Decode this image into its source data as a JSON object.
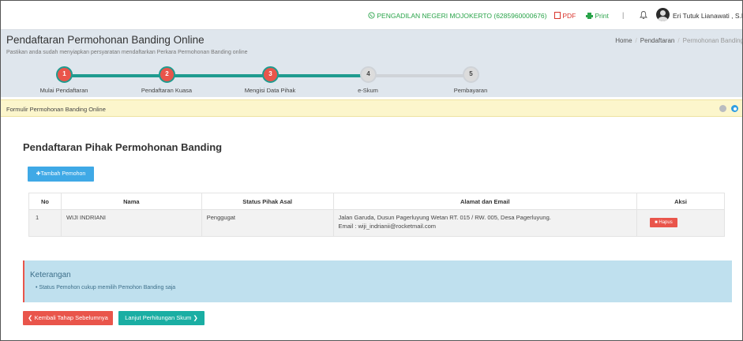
{
  "topbar": {
    "court": "PENGADILAN NEGERI MOJOKERTO (6285960000676)",
    "pdf": "PDF",
    "print": "Print",
    "separator": "|",
    "user": "Eri Tutuk Lianawati , S.H."
  },
  "header": {
    "title": "Pendaftaran Permohonan Banding Online",
    "subtitle": "Pastikan anda sudah menyiapkan persyaratan mendaftarkan Perkara Permohonan Banding online",
    "breadcrumb": [
      "Home",
      "Pendaftaran",
      "Permohonan Banding"
    ]
  },
  "steps": [
    {
      "num": "1",
      "label": "Mulai Pendaftaran"
    },
    {
      "num": "2",
      "label": "Pendaftaran Kuasa"
    },
    {
      "num": "3",
      "label": "Mengisi Data Pihak"
    },
    {
      "num": "4",
      "label": "e-Skum"
    },
    {
      "num": "5",
      "label": "Pembayaran"
    }
  ],
  "formbar": {
    "label": "Formulir Permohonan Banding Online"
  },
  "section": {
    "title": "Pendaftaran Pihak Permohonan Banding",
    "add_button": "Tambah Pemohon"
  },
  "table": {
    "headers": [
      "No",
      "Nama",
      "Status Pihak Asal",
      "Alamat dan Email",
      "Aksi"
    ],
    "rows": [
      {
        "no": "1",
        "nama": "WIJI INDRIANI",
        "status": "Penggugat",
        "alamat": "Jalan Garuda, Dusun Pagerluyung Wetan RT. 015 / RW. 005, Desa Pagerluyung.",
        "email": "Email : wiji_indrianii@rocketmail.com",
        "action": "Hapus"
      }
    ]
  },
  "info": {
    "heading": "Keterangan",
    "item": "Status Pemohon cukup memilih Pemohon Banding saja"
  },
  "buttons": {
    "back": "Kembali Tahap Sebelumnya",
    "next": "Lanjut Perhitungan Skum"
  },
  "colors": {
    "accent_teal": "#1f9b8f",
    "step_done": "#e9554b",
    "info_bg": "#bfe0ee",
    "button_blue": "#3fa9e6"
  }
}
